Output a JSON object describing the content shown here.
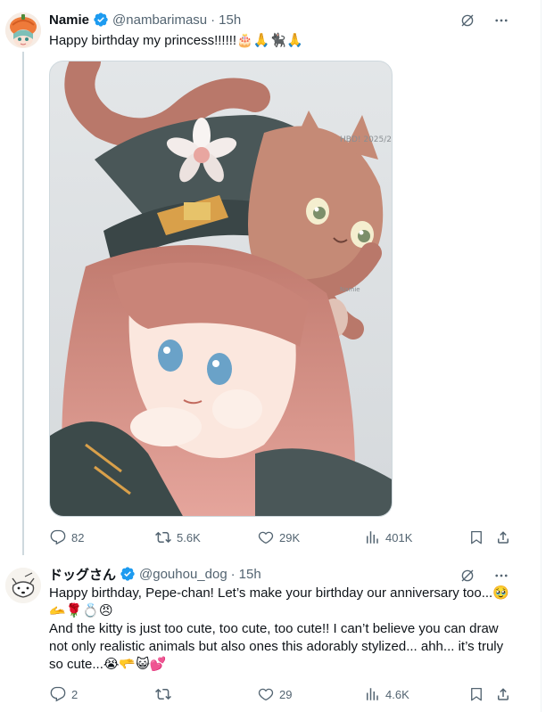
{
  "tweet1": {
    "display_name": "Namie",
    "handle": "@nambarimasu",
    "separator": "·",
    "time": "15h",
    "text": "Happy birthday my princess!!!!!!🎂🙏🐈‍⬛🙏",
    "media_signature": "HBD! 2025/2",
    "media_watermark": "Namie",
    "metrics": {
      "replies": "82",
      "reposts": "5.6K",
      "likes": "29K",
      "views": "401K"
    }
  },
  "tweet2": {
    "display_name": "ドッグさん",
    "handle": "@gouhou_dog",
    "separator": "·",
    "time": "15h",
    "paragraphs": [
      "Happy birthday, Pepe-chan! Let’s make your birthday our anniversary too...🥹🫴🌹💍😠",
      "And the kitty is just too cute, too cute, too cute!! I can’t believe you can draw not only realistic animals but also ones this adorably stylized... ahh... it’s truly so cute...😭🫳😺💕"
    ],
    "metrics": {
      "replies": "2",
      "reposts": "",
      "likes": "29",
      "views": "4.6K"
    }
  },
  "colors": {
    "text_primary": "#0f1419",
    "text_secondary": "#536471",
    "verified_blue": "#1d9bf0",
    "thread_line": "#cfd9de"
  }
}
